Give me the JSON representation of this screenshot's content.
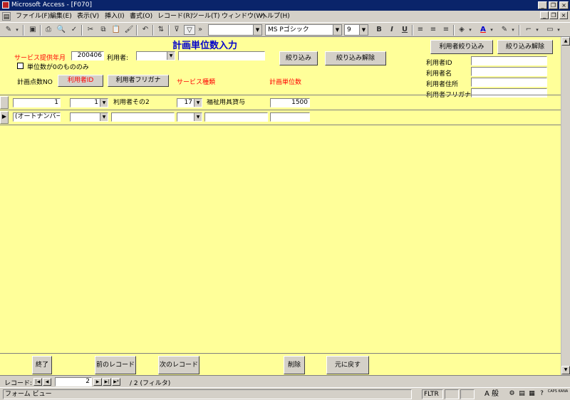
{
  "window": {
    "title": "Microsoft Access - [F070]"
  },
  "menu": [
    "ファイル(F)",
    "編集(E)",
    "表示(V)",
    "挿入(I)",
    "書式(O)",
    "レコード(R)",
    "ツール(T)",
    "ウィンドウ(W)",
    "ヘルプ(H)"
  ],
  "toolbar": {
    "font_name": "MS Pゴシック",
    "font_size": "9",
    "bold": "B",
    "italic": "I",
    "underline": "U"
  },
  "form": {
    "title": "計画単位数入力",
    "service_month_label": "サービス提供年月",
    "service_month_value": "200406",
    "user_label": "利用者:",
    "zero_units_label": "単位数が0のもののみ",
    "filter_button": "絞り込み",
    "filter_clear_button": "絞り込み解除",
    "user_filter_button": "利用者絞り込み",
    "user_filter_clear_button": "絞り込み解除",
    "user_id_label": "利用者ID",
    "user_name_label": "利用者名",
    "user_address_label": "利用者住所",
    "user_kana_label": "利用者フリガナ",
    "plan_no_label": "計画点数NO",
    "sort_user_id_button": "利用者ID",
    "sort_user_kana_button": "利用者フリガナ",
    "service_type_label": "サービス種類",
    "plan_units_label": "計画単位数"
  },
  "records": [
    {
      "no": "1",
      "user_id": "1",
      "user_name": "利用者その2",
      "service_code": "17",
      "service_name": "福祉用具貸与",
      "units": "1500"
    },
    {
      "no": "(オートナンバー)",
      "user_id": "",
      "user_name": "",
      "service_code": "",
      "service_name": "",
      "units": ""
    }
  ],
  "footer": {
    "exit_button": "終了",
    "prev_button": "前のレコード",
    "next_button": "次のレコード",
    "delete_button": "削除",
    "undo_button": "元に戻す"
  },
  "nav": {
    "label": "レコード:",
    "current": "2",
    "total": "/ 2 (フィルタ)"
  },
  "status": {
    "view": "フォーム ビュー",
    "fltr": "FLTR",
    "ime": "A 般",
    "caps": "CAPS KANA"
  }
}
